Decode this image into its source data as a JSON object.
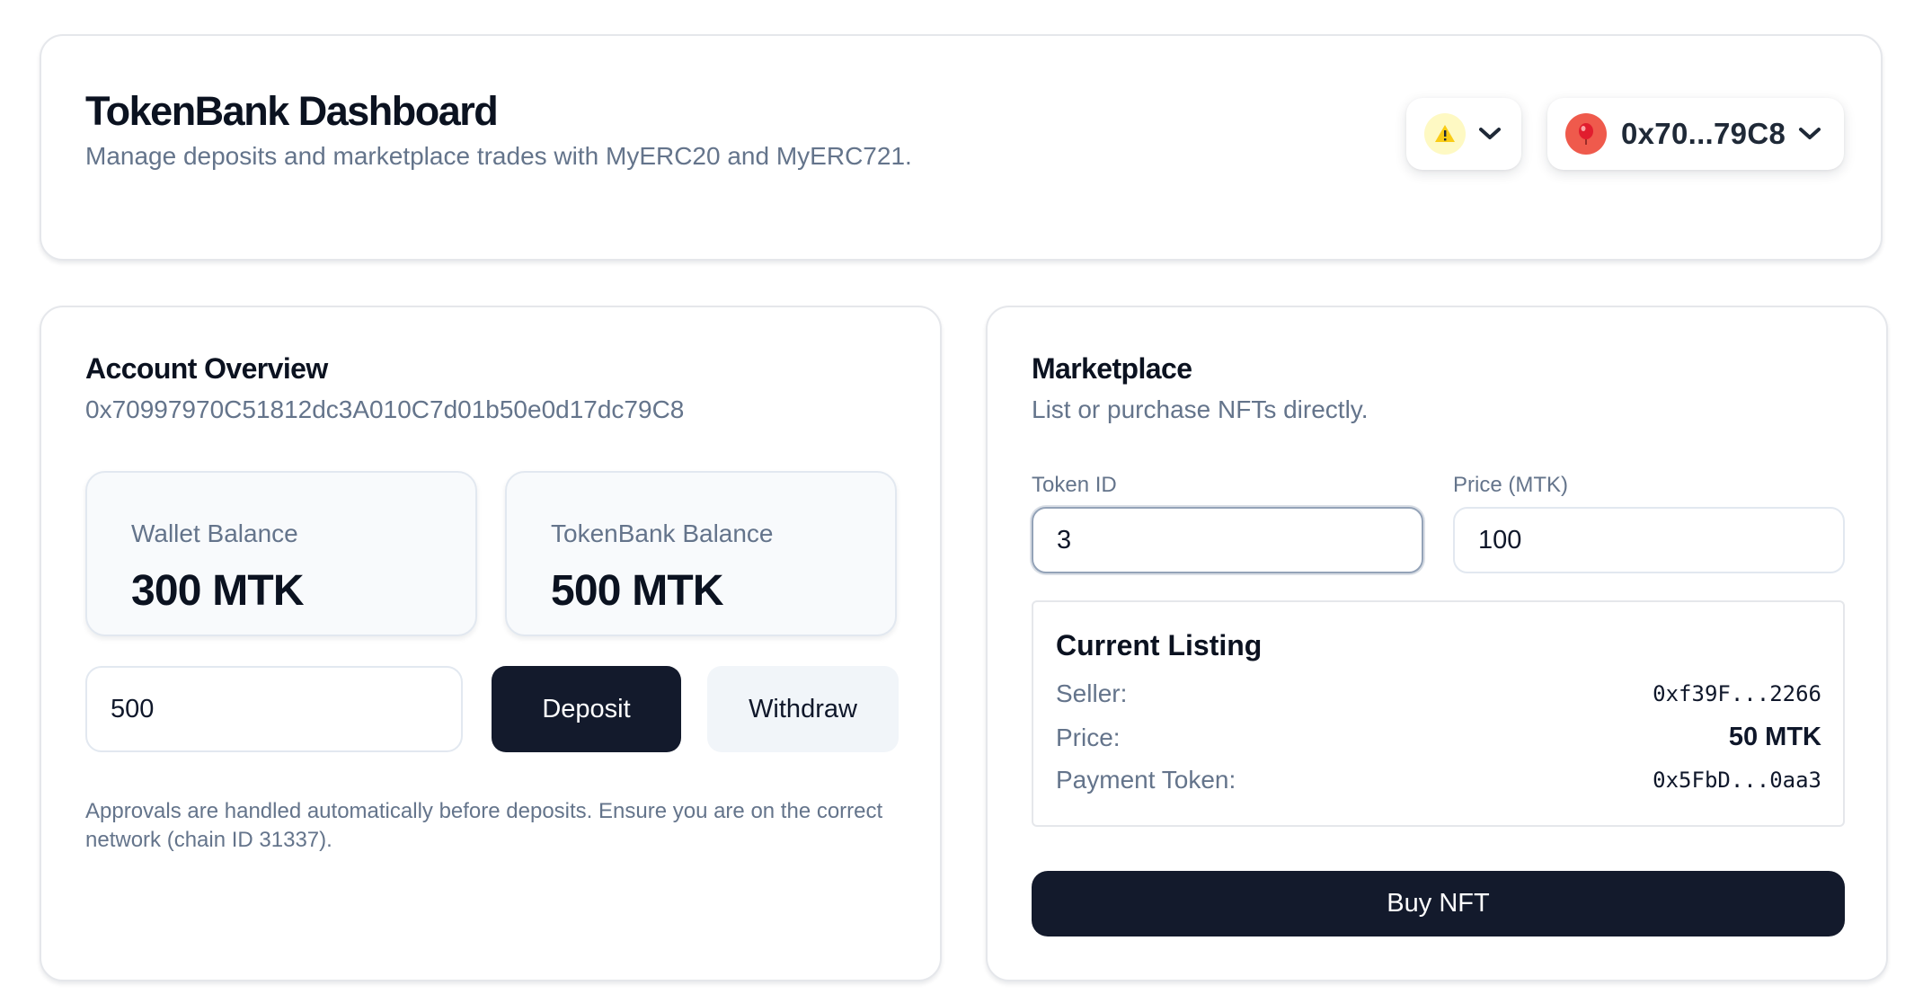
{
  "header": {
    "title": "TokenBank Dashboard",
    "subtitle": "Manage deposits and marketplace trades with MyERC20 and MyERC721.",
    "chain_icon": "warning-icon",
    "account_short": "0x70...79C8"
  },
  "account": {
    "title": "Account Overview",
    "address": "0x70997970C51812dc3A010C7d01b50e0d17dc79C8",
    "wallet_label": "Wallet Balance",
    "wallet_value": "300 MTK",
    "bank_label": "TokenBank Balance",
    "bank_value": "500 MTK",
    "amount_value": "500",
    "deposit_label": "Deposit",
    "withdraw_label": "Withdraw",
    "note": "Approvals are handled automatically before deposits. Ensure you are on the correct network (chain ID 31337)."
  },
  "market": {
    "title": "Marketplace",
    "subtitle": "List or purchase NFTs directly.",
    "token_id_label": "Token ID",
    "token_id_value": "3",
    "price_label": "Price (MTK)",
    "price_value": "100",
    "listing": {
      "title": "Current Listing",
      "seller_label": "Seller:",
      "seller_value": "0xf39F...2266",
      "price_label": "Price:",
      "price_value": "50 MTK",
      "payment_label": "Payment Token:",
      "payment_value": "0x5FbD...0aa3"
    },
    "buy_label": "Buy NFT"
  },
  "colors": {
    "primary_button": "#131a2c",
    "muted_text": "#64748b",
    "avatar": "#ef5a4c",
    "chain_badge": "#fef9c3"
  }
}
